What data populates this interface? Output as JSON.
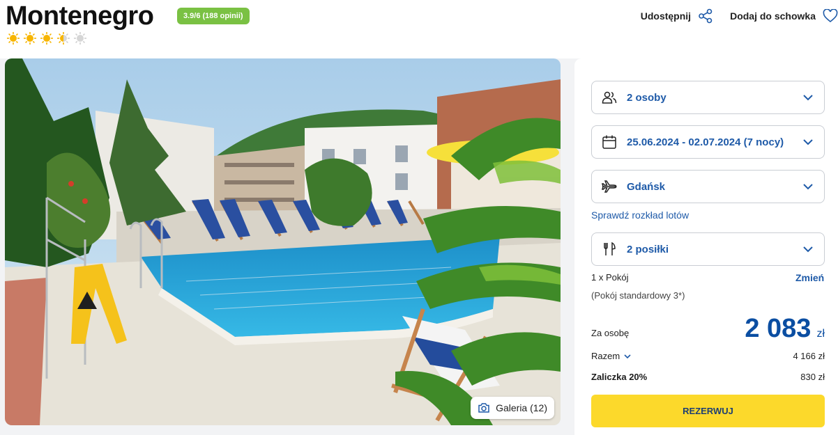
{
  "hotel": {
    "title": "Montenegro",
    "rating_badge": "3.9/6 (188 opinii)",
    "stars": 3.5,
    "max_stars": 5
  },
  "actions": {
    "share_label": "Udostępnij",
    "save_label": "Dodaj do schowka"
  },
  "gallery": {
    "label": "Galeria (12)"
  },
  "booking": {
    "persons": "2 osoby",
    "dates": "25.06.2024 - 02.07.2024 (7 nocy)",
    "departure": "Gdańsk",
    "flights_link": "Sprawdź rozkład lotów",
    "meals": "2 posiłki",
    "room": "1 x Pokój",
    "room_type": "(Pokój standardowy 3*)",
    "change_label": "Zmień",
    "per_person_label": "Za osobę",
    "price_per_person": "2 083",
    "currency": "zł",
    "total_label": "Razem",
    "total_value": "4 166 zł",
    "deposit_label": "Zaliczka 20%",
    "deposit_value": "830 zł",
    "reserve_label": "REZERWUJ"
  },
  "colors": {
    "accent_blue": "#1e5aa8",
    "rating_green": "#7ac143",
    "reserve_yellow": "#fcd92b",
    "star_yellow": "#f7b500"
  }
}
